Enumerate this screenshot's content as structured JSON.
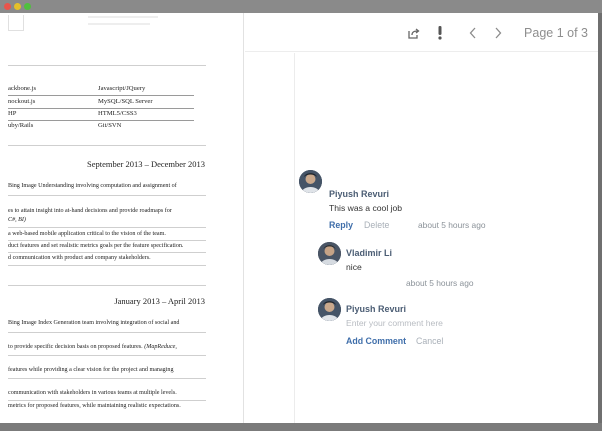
{
  "window": {
    "controls": [
      "close",
      "minimize",
      "zoom"
    ]
  },
  "toolbar": {
    "share_icon": "share-icon",
    "flag_icon": "exclamation-icon",
    "prev_icon": "chevron-left-icon",
    "next_icon": "chevron-right-icon",
    "page_indicator": "Page 1 of 3"
  },
  "document": {
    "skills": [
      {
        "left": "ackbone.js",
        "right": "Javascript/JQuery"
      },
      {
        "left": "nockout.js",
        "right": "MySQL/SQL Server"
      },
      {
        "left": "HP",
        "right": "HTML5/CSS3"
      },
      {
        "left": "uby/Rails",
        "right": "Git/SVN"
      }
    ],
    "job1": {
      "date": "September 2013 – December 2013",
      "lines": [
        "Bing Image Understanding involving computation and assignment of",
        "es to attain insight into at-hand decisions and provide roadmaps for",
        "C#, BI)",
        "a web-based mobile application critical to the vision of the team.",
        "duct features and set realistic metrics goals per the feature specification.",
        "d communication with product and company stakeholders."
      ]
    },
    "job2": {
      "date": "January 2013 – April 2013",
      "lines": [
        "Bing Image Index Generation team involving integration of social and",
        "to provide specific decision basis on proposed features.",
        "(MapReduce,",
        "features while providing a clear vision for the project and managing",
        "communication with stakeholders in various teams at multiple levels.",
        "metrics for proposed features, while maintaining realistic expectations."
      ]
    }
  },
  "comments": {
    "thread": [
      {
        "author": "Piyush Revuri",
        "text": "This was a cool job",
        "reply_label": "Reply",
        "delete_label": "Delete",
        "time": "about 5 hours ago"
      },
      {
        "author": "Vladimir Li",
        "text": "nice",
        "time": "about 5 hours ago"
      }
    ],
    "composer": {
      "author": "Piyush Revuri",
      "placeholder": "Enter your comment here",
      "submit_label": "Add Comment",
      "cancel_label": "Cancel"
    }
  },
  "colors": {
    "accent": "#3f6eaa",
    "author": "#4b5d74",
    "muted": "#a9b0b8",
    "page_indicator": "#8e8e8e"
  }
}
